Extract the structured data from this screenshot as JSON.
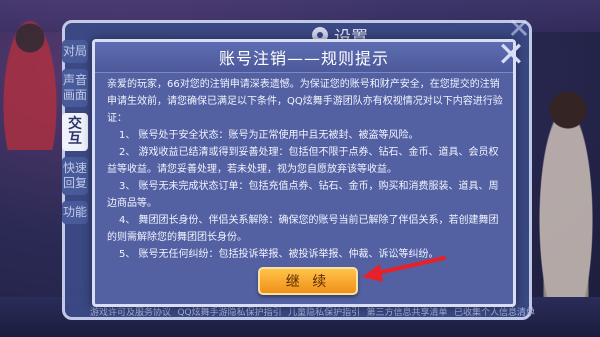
{
  "settings": {
    "title": "设置",
    "close_glyph": "✕",
    "tabs": [
      {
        "label": "对局"
      },
      {
        "label": "声音画面"
      },
      {
        "label": "交互"
      },
      {
        "label": "快速回复"
      },
      {
        "label": "功能"
      }
    ],
    "footer_links": [
      "游戏许可及服务协议",
      "QQ炫舞手游隐私保护指引",
      "儿童隐私保护指引",
      "第三方信息共享清单",
      "已收集个人信息清单"
    ]
  },
  "dialog": {
    "title": "账号注销——规则提示",
    "close_glyph": "✕",
    "intro": "亲爱的玩家，66对您的注销申请深表遗憾。为保证您的账号和财产安全，在您提交的注销申请生效前，请您确保已满足以下条件，QQ炫舞手游团队亦有权视情况对以下内容进行验证：",
    "items": [
      "1、 账号处于安全状态：账号为正常使用中且无被封、被盗等风险。",
      "2、 游戏收益已结清或得到妥善处理：包括但不限于点券、钻石、金币、道具、会员权益等收益。请您妥善处理，若未处理，视为您自愿放弃该等收益。",
      "3、 账号无未完成状态订单：包括充值点券、钻石、金币，购买和消费服装、道具、周边商品等。",
      "4、 舞团团长身份、伴侣关系解除：确保您的账号当前已解除了伴侣关系，若创建舞团的则需解除您的舞团团长身份。",
      "5、 账号无任何纠纷：包括投诉举报、被投诉举报、仲裁、诉讼等纠纷。"
    ],
    "continue_label": "继 续"
  },
  "colors": {
    "dialog_bg": "#5361a2",
    "button_gradient_top": "#ffc34a",
    "button_gradient_bottom": "#f0901a",
    "annotation_arrow": "#e8202a"
  }
}
